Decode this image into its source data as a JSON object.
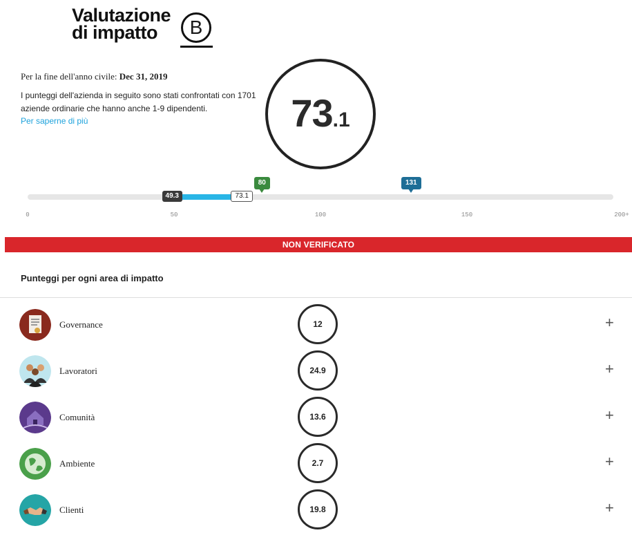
{
  "logo": {
    "line1": "Valutazione",
    "line2": "di impatto",
    "badge": "B"
  },
  "fiscal_year": {
    "label": "Per la fine dell'anno civile:",
    "value": "Dec 31, 2019"
  },
  "description": "I punteggi dell'azienda in seguito sono stati confrontati con 1701 aziende ordinarie che hanno anche 1-9 dipendenti.",
  "learn_more": "Per saperne di più",
  "score": {
    "main": "73",
    "decimal": ".1",
    "value": 73.1
  },
  "scale": {
    "min": 0,
    "max": 200,
    "ticks": [
      "0",
      "50",
      "100",
      "150",
      "200+"
    ],
    "range_low": 49.3,
    "range_low_label": "49.3",
    "score_label": "73.1",
    "flags": [
      {
        "value": 80,
        "label": "80",
        "color": "#3a8a3e"
      },
      {
        "value": 131,
        "label": "131",
        "color": "#1e6e96"
      }
    ]
  },
  "banner": "NON VERIFICATO",
  "section_title": "Punteggi per ogni area di impatto",
  "areas": [
    {
      "label": "Governance",
      "score": "12",
      "icon": "governance-icon"
    },
    {
      "label": "Lavoratori",
      "score": "24.9",
      "icon": "workers-icon"
    },
    {
      "label": "Comunità",
      "score": "13.6",
      "icon": "community-icon"
    },
    {
      "label": "Ambiente",
      "score": "2.7",
      "icon": "environment-icon"
    },
    {
      "label": "Clienti",
      "score": "19.8",
      "icon": "customers-icon"
    }
  ],
  "expand_symbol": "+",
  "colors": {
    "banner": "#d9262b",
    "link": "#1da2dc",
    "range_fill": "#29b5e6",
    "governance": "#8a2a1e",
    "workers": "#33b2c8",
    "community": "#5b3a8c",
    "environment": "#4aa04a",
    "customers": "#25a5a6"
  }
}
